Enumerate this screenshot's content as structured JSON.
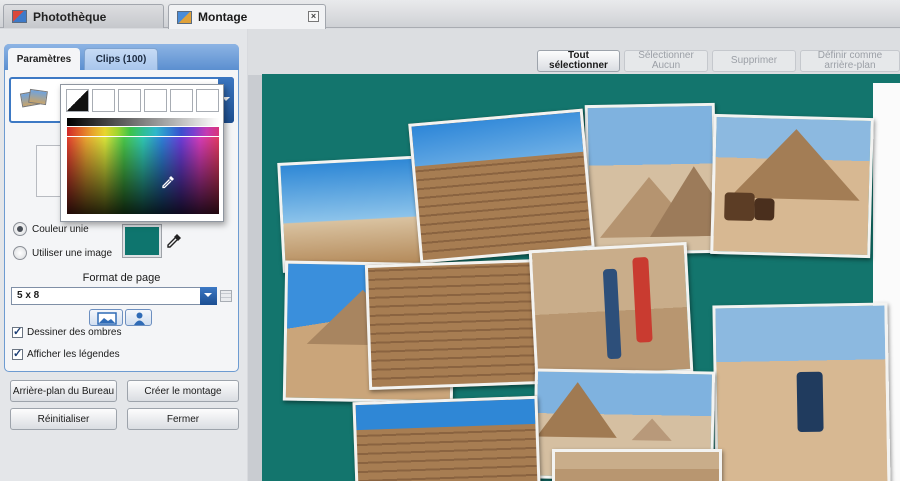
{
  "tabs": [
    {
      "label": "Photothèque",
      "active": false
    },
    {
      "label": "Montage",
      "active": true
    }
  ],
  "panel": {
    "tabs": [
      {
        "label": "Paramètres",
        "selected": true
      },
      {
        "label": "Clips (100)",
        "selected": false
      }
    ],
    "background_options": [
      {
        "label": "Couleur unie",
        "selected": true
      },
      {
        "label": "Utiliser une image",
        "selected": false
      }
    ],
    "color_swatch": "#0e756e",
    "page_format": {
      "label": "Format de page",
      "value": "5 x 8"
    },
    "checkboxes": [
      {
        "label": "Dessiner des ombres",
        "checked": true
      },
      {
        "label": "Afficher les légendes",
        "checked": true
      }
    ]
  },
  "buttons": {
    "desktop_background": "Arrière-plan du Bureau",
    "create_montage": "Créer le montage",
    "reset": "Réinitialiser",
    "close": "Fermer"
  },
  "toolbar": {
    "select_all": "Tout sélectionner",
    "select_none": "Sélectionner Aucun",
    "delete": "Supprimer",
    "set_background": "Définir comme arrière-plan"
  },
  "icons": {
    "tab_library": "photo-library-icon",
    "tab_montage": "montage-icon",
    "close": "close-icon",
    "eyedropper": "eyedropper-icon",
    "landscape": "landscape-orientation-icon",
    "portrait": "portrait-orientation-icon"
  },
  "colors": {
    "canvas": "#13756d",
    "accent": "#3d79c4"
  }
}
